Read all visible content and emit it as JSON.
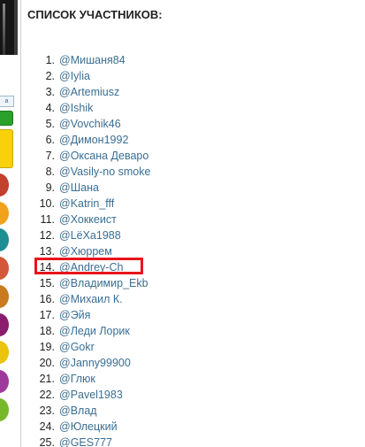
{
  "header": {
    "title": "СПИСОК УЧАСТНИКОВ:"
  },
  "sidebar_strip": {
    "tab_label": "a",
    "avatar_colors": [
      "#c2402c",
      "#f0a21a",
      "#1d8e92",
      "#d4573b",
      "#c97b1f",
      "#8a1d6e",
      "#eac40d",
      "#9d3a9d",
      "#76b82a"
    ]
  },
  "highlighted_row": 14,
  "colors": {
    "link": "#3b6e93",
    "highlight": "#e8141c"
  },
  "participants": [
    {
      "num": "1.",
      "name": "@Мишаня84"
    },
    {
      "num": "2.",
      "name": "@Iylia"
    },
    {
      "num": "3.",
      "name": "@Artemiusz"
    },
    {
      "num": "4.",
      "name": "@Ishik"
    },
    {
      "num": "5.",
      "name": "@Vovchik46"
    },
    {
      "num": "6.",
      "name": "@Димон1992"
    },
    {
      "num": "7.",
      "name": "@Оксана Деваро"
    },
    {
      "num": "8.",
      "name": "@Vasily-no smoke"
    },
    {
      "num": "9.",
      "name": "@Шана"
    },
    {
      "num": "10.",
      "name": "@Katrin_fff"
    },
    {
      "num": "11.",
      "name": "@Хоккеист"
    },
    {
      "num": "12.",
      "name": "@LёXa1988"
    },
    {
      "num": "13.",
      "name": "@Хюррем"
    },
    {
      "num": "14.",
      "name": "@Andrey-Ch"
    },
    {
      "num": "15.",
      "name": "@Владимир_Ekb"
    },
    {
      "num": "16.",
      "name": "@Михаил К."
    },
    {
      "num": "17.",
      "name": "@Эйя"
    },
    {
      "num": "18.",
      "name": "@Леди Лорик"
    },
    {
      "num": "19.",
      "name": "@Gokr"
    },
    {
      "num": "20.",
      "name": "@Janny99900"
    },
    {
      "num": "21.",
      "name": "@Глюк"
    },
    {
      "num": "22.",
      "name": "@Pavel1983"
    },
    {
      "num": "23.",
      "name": "@Влад"
    },
    {
      "num": "24.",
      "name": "@Юлецкий"
    },
    {
      "num": "25.",
      "name": "@GES777"
    }
  ]
}
